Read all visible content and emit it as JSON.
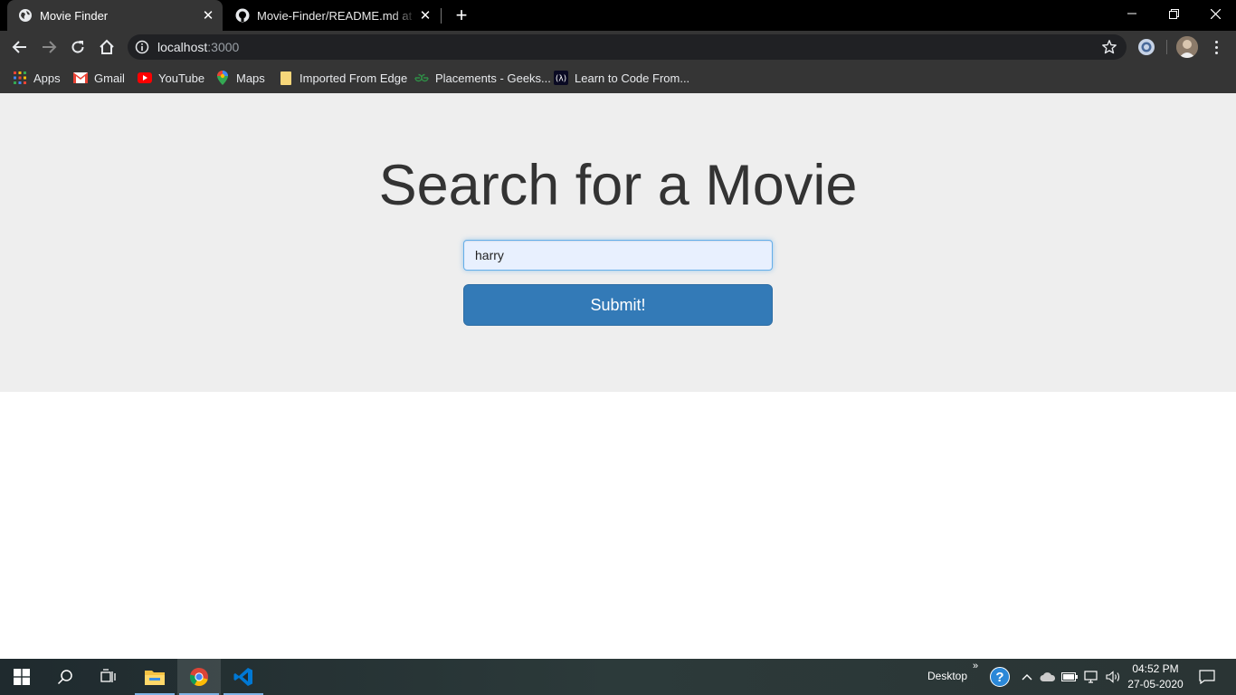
{
  "browser": {
    "tabs": [
      {
        "title": "Movie Finder",
        "active": true,
        "favicon": "globe-icon"
      },
      {
        "title": "Movie-Finder/README.md at master",
        "active": false,
        "favicon": "github-icon"
      }
    ],
    "address": {
      "host": "localhost",
      "port": ":3000"
    },
    "bookmarks": [
      {
        "label": "Apps",
        "icon": "apps-grid-icon"
      },
      {
        "label": "Gmail",
        "icon": "gmail-icon"
      },
      {
        "label": "YouTube",
        "icon": "youtube-icon"
      },
      {
        "label": "Maps",
        "icon": "maps-pin-icon"
      },
      {
        "label": "Imported From Edge",
        "icon": "folder-icon"
      },
      {
        "label": "Placements - Geeks...",
        "icon": "geeksforgeeks-icon"
      },
      {
        "label": "Learn to Code From...",
        "icon": "freecodecamp-icon"
      }
    ]
  },
  "page": {
    "heading": "Search for a Movie",
    "search": {
      "value": "harry",
      "placeholder": ""
    },
    "submit_label": "Submit!"
  },
  "taskbar": {
    "desktop_label": "Desktop",
    "time": "04:52 PM",
    "date": "27-05-2020"
  },
  "colors": {
    "jumbotron_bg": "#eeeeee",
    "button_primary": "#337ab7",
    "browser_frame": "#353535"
  }
}
